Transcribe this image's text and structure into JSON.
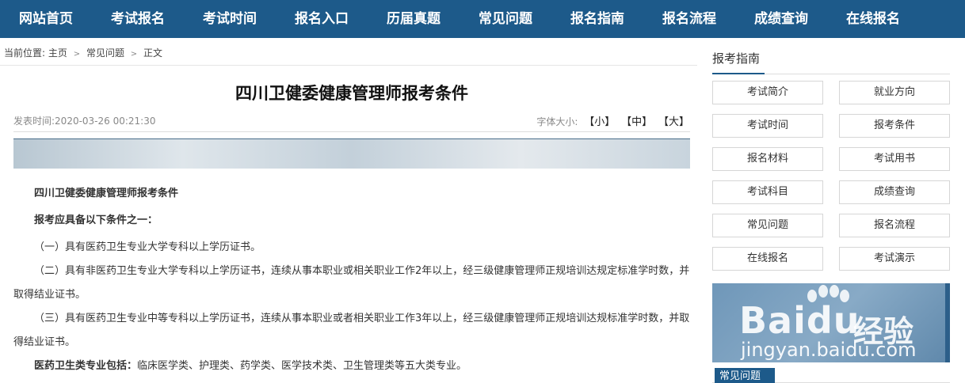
{
  "nav": [
    {
      "label": "网站首页"
    },
    {
      "label": "考试报名"
    },
    {
      "label": "考试时间"
    },
    {
      "label": "报名入口"
    },
    {
      "label": "历届真题"
    },
    {
      "label": "常见问题"
    },
    {
      "label": "报名指南"
    },
    {
      "label": "报名流程"
    },
    {
      "label": "成绩查询"
    },
    {
      "label": "在线报名"
    }
  ],
  "breadcrumb": {
    "prefix": "当前位置:",
    "home": "主页",
    "section": "常见问题",
    "current": "正文"
  },
  "article": {
    "title": "四川卫健委健康管理师报考条件",
    "publish_time": "发表时间:2020-03-26 00:21:30",
    "font_size_label": "字体大小:",
    "font_small": "【小】",
    "font_medium": "【中】",
    "font_large": "【大】",
    "paragraphs": {
      "p1": "四川卫健委健康管理师报考条件",
      "p2": "报考应具备以下条件之一：",
      "p3": "（一）具有医药卫生专业大学专科以上学历证书。",
      "p4": "（二）具有非医药卫生专业大学专科以上学历证书，连续从事本职业或相关职业工作2年以上，经三级健康管理师正规培训达规定标准学时数，并取得结业证书。",
      "p5": "（三）具有医药卫生专业中等专科以上学历证书，连续从事本职业或者相关职业工作3年以上，经三级健康管理师正规培训达规标准学时数，并取得结业证书。",
      "p6_bold": "医药卫生类专业包括：",
      "p6_rest": "临床医学类、护理类、药学类、医学技术类、卫生管理类等五大类专业。"
    }
  },
  "sidebar": {
    "title": "报考指南",
    "links": [
      {
        "label": "考试简介"
      },
      {
        "label": "就业方向"
      },
      {
        "label": "考试时间"
      },
      {
        "label": "报考条件"
      },
      {
        "label": "报名材料"
      },
      {
        "label": "考试用书"
      },
      {
        "label": "考试科目"
      },
      {
        "label": "成绩查询"
      },
      {
        "label": "常见问题"
      },
      {
        "label": "报名流程"
      },
      {
        "label": "在线报名"
      },
      {
        "label": "考试演示"
      }
    ],
    "watermark": {
      "brand": "Bai",
      "brand2": "du",
      "cn": "经验",
      "url": "jingyan.baidu.com"
    },
    "bottom_tab": "常见问题"
  }
}
